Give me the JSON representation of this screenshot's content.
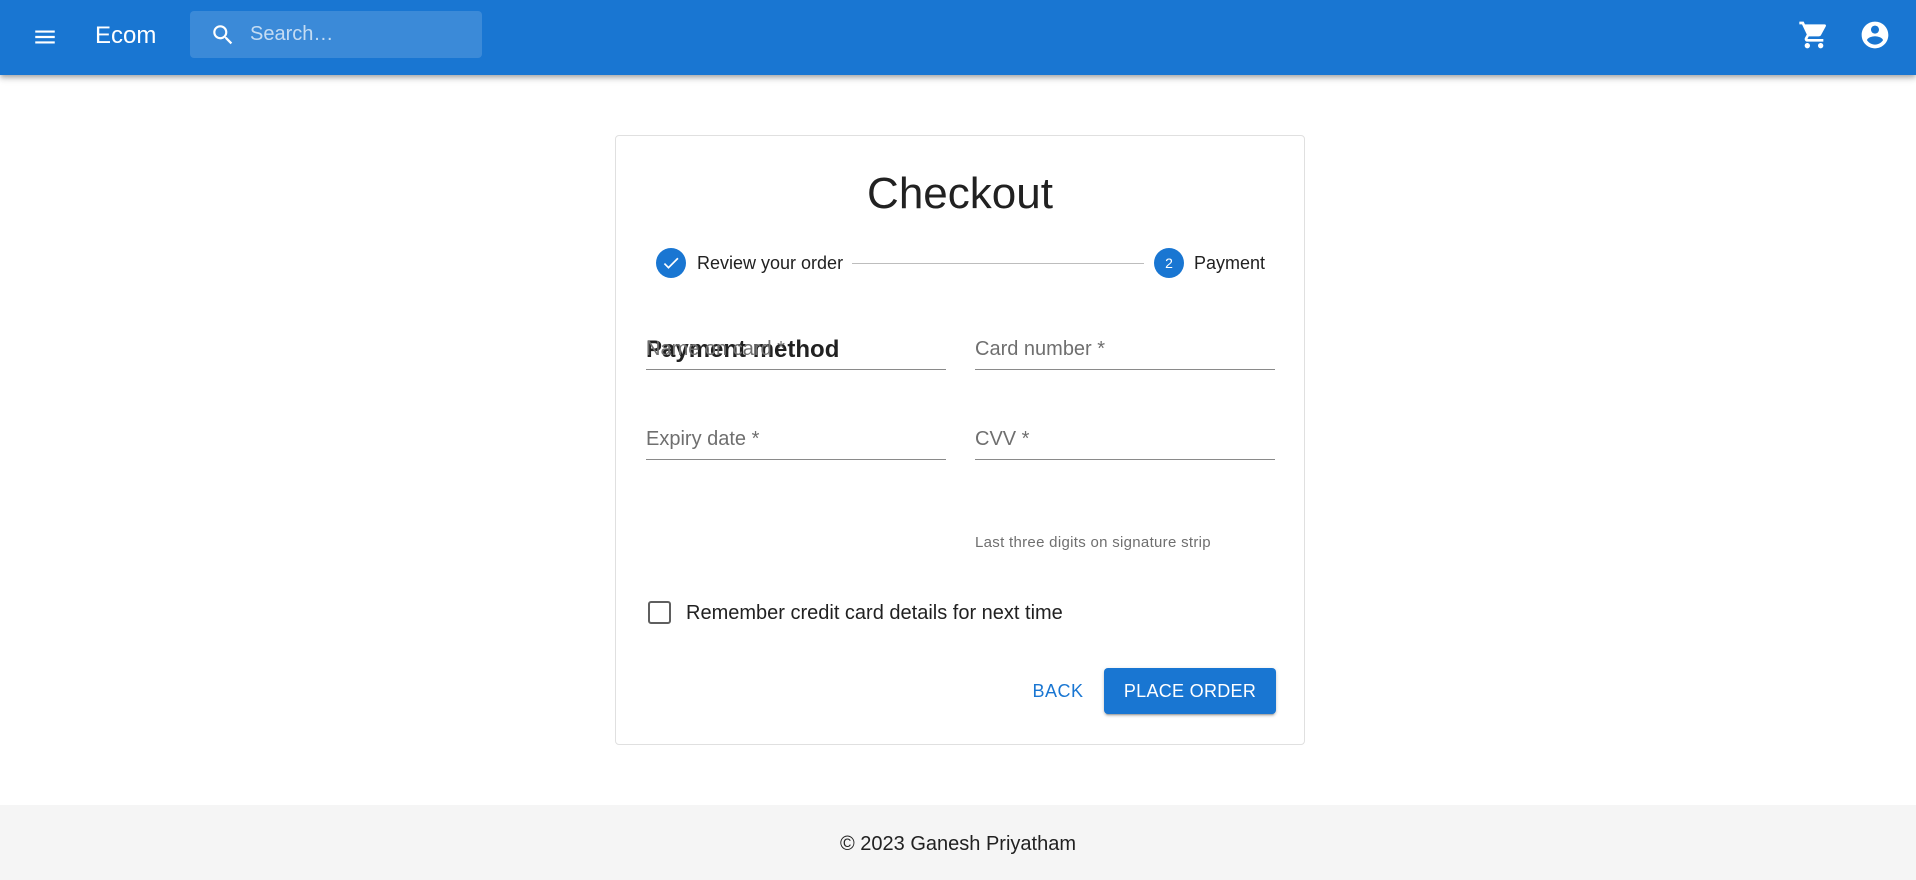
{
  "appbar": {
    "brand": "Ecom",
    "search_placeholder": "Search…",
    "menu_icon": "menu-icon",
    "cart_icon": "shopping-cart-icon",
    "account_icon": "account-circle-icon",
    "color": "#1976d2"
  },
  "checkout": {
    "title": "Checkout",
    "steps": [
      {
        "label": "Review your order",
        "state": "completed",
        "icon": "check-icon"
      },
      {
        "label": "Payment",
        "state": "active",
        "number": "2"
      }
    ],
    "section_title": "Payment method",
    "fields": {
      "name_on_card": {
        "placeholder": "Name on card *",
        "value": ""
      },
      "card_number": {
        "placeholder": "Card number *",
        "value": ""
      },
      "expiry_date": {
        "placeholder": "Expiry date *",
        "value": ""
      },
      "cvv": {
        "placeholder": "CVV *",
        "value": "",
        "helper": "Last three digits on signature strip"
      }
    },
    "remember_checkbox": {
      "label": "Remember credit card details for next time",
      "checked": false
    },
    "buttons": {
      "back": "BACK",
      "place_order": "PLACE ORDER"
    }
  },
  "footer": {
    "copyright": "© 2023 Ganesh Priyatham"
  }
}
